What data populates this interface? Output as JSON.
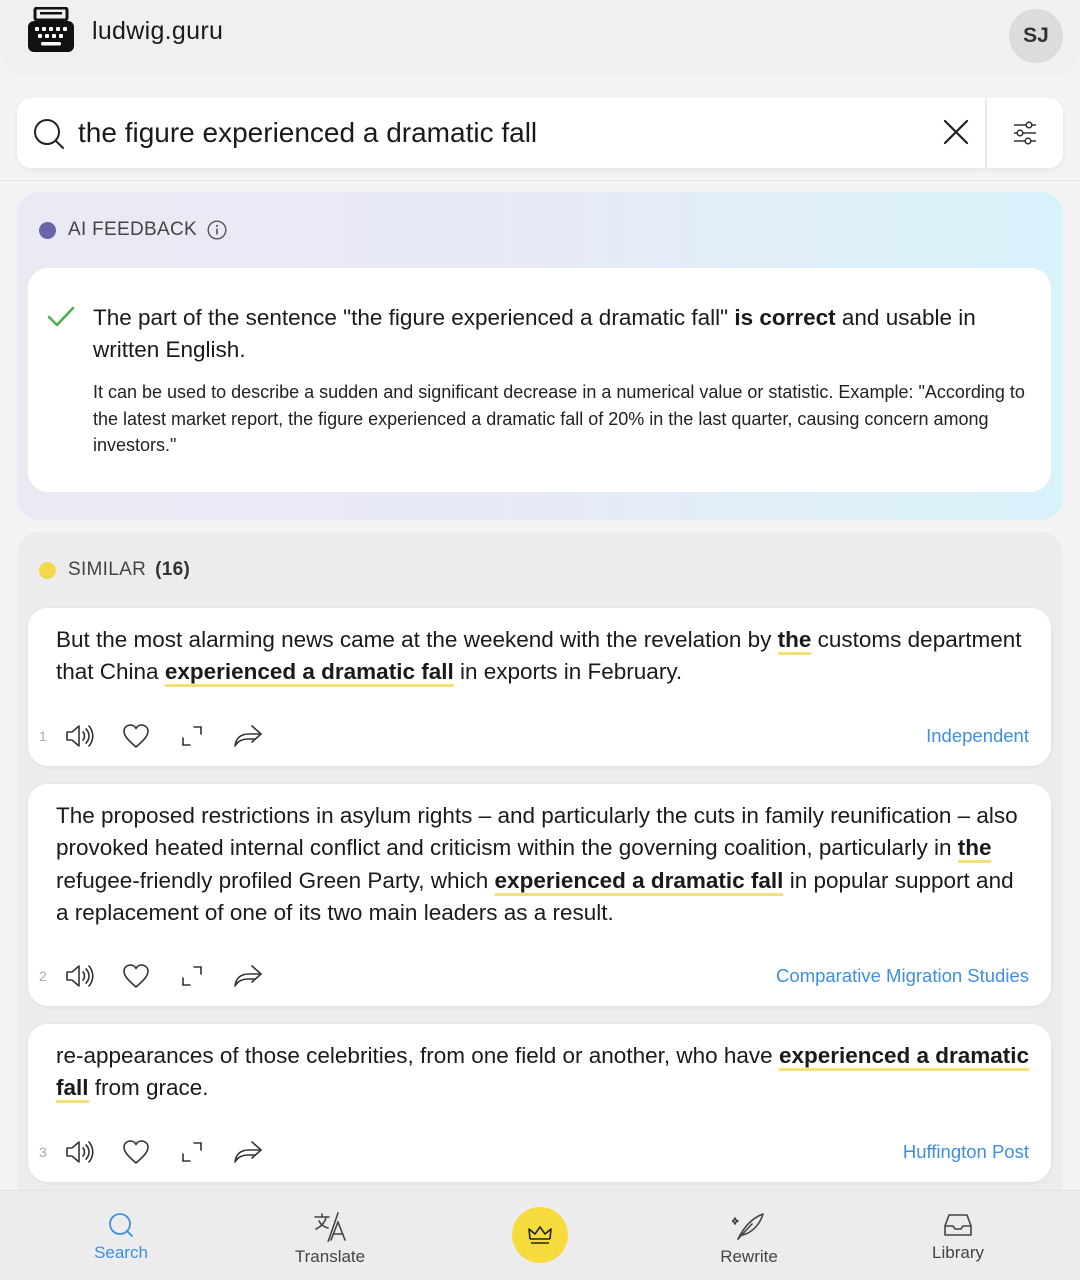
{
  "header": {
    "site_name": "ludwig.guru",
    "avatar_initials": "SJ"
  },
  "search": {
    "query": "the figure experienced a dramatic fall"
  },
  "ai_feedback": {
    "heading": "AI FEEDBACK",
    "main_pre": "The part of the sentence \"the figure experienced a dramatic fall\" ",
    "main_bold": "is correct",
    "main_post": " and usable in written English.",
    "detail": "It can be used to describe a sudden and significant decrease in a numerical value or statistic. Example: \"According to the latest market report, the figure experienced a dramatic fall of 20% in the last quarter, causing concern among investors.\""
  },
  "similar": {
    "heading": "SIMILAR",
    "count": "(16)",
    "results": [
      {
        "num": "1",
        "source": "Independent",
        "segments": [
          {
            "t": "But the most alarming news came at the weekend with the revelation by ",
            "h": false
          },
          {
            "t": "the",
            "h": true
          },
          {
            "t": " customs department that China ",
            "h": false
          },
          {
            "t": "experienced a dramatic fall",
            "h": true
          },
          {
            "t": " in exports in February.",
            "h": false
          }
        ]
      },
      {
        "num": "2",
        "source": "Comparative Migration Studies",
        "segments": [
          {
            "t": "The proposed restrictions in asylum rights – and particularly the cuts in family reunification – also provoked heated internal conflict and criticism within the governing coalition, particularly in ",
            "h": false
          },
          {
            "t": "the",
            "h": true
          },
          {
            "t": " refugee-friendly profiled Green Party, which ",
            "h": false
          },
          {
            "t": "experienced a dramatic fall",
            "h": true
          },
          {
            "t": " in popular support and a replacement of one of its two main leaders as a result.",
            "h": false
          }
        ]
      },
      {
        "num": "3",
        "source": "Huffington Post",
        "segments": [
          {
            "t": "re-appearances of those celebrities, from one field or another, who have ",
            "h": false
          },
          {
            "t": "experienced a dramatic fall",
            "h": true
          },
          {
            "t": " from grace.",
            "h": false
          }
        ]
      }
    ]
  },
  "nav": {
    "search": "Search",
    "translate": "Translate",
    "rewrite": "Rewrite",
    "library": "Library"
  },
  "colors": {
    "accent": "#3d8fe0",
    "highlight": "#f4e07a",
    "ai_dot": "#6a64a8",
    "similar_dot": "#f2d84a",
    "crown": "#f5dc3c"
  }
}
